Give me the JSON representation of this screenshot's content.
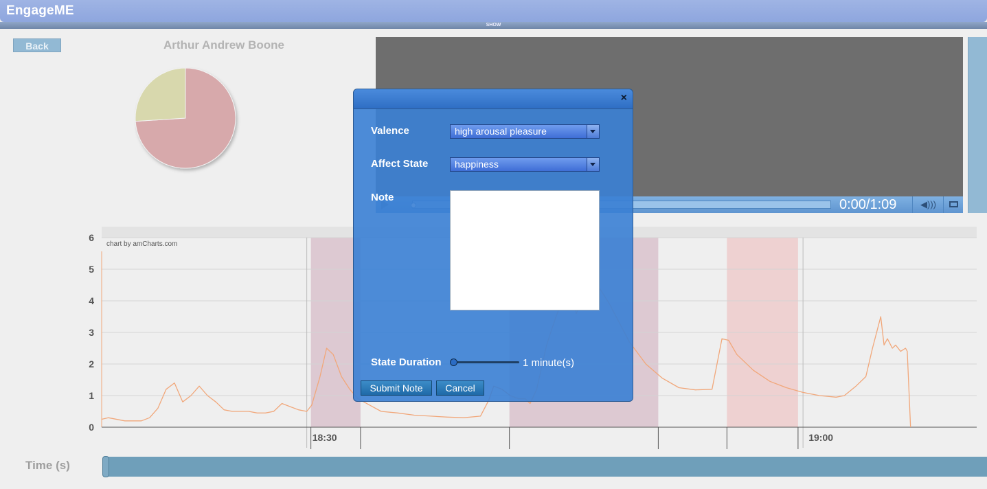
{
  "app": {
    "title": "EngageME",
    "show_label": "SHOW",
    "back_label": "Back",
    "person_name": "Arthur Andrew Boone"
  },
  "pie": {
    "slices": [
      {
        "value": 74,
        "color": "#d7a9ab"
      },
      {
        "value": 26,
        "color": "#d8d8ad"
      }
    ]
  },
  "video": {
    "time_display": "0:00/1:09",
    "progress": 0
  },
  "chart_data": {
    "type": "line",
    "watermark": "chart by amCharts.com",
    "ylim": [
      0,
      6
    ],
    "y_ticks": [
      "0",
      "1",
      "2",
      "3",
      "4",
      "5",
      "6"
    ],
    "x_tick_labels": [
      {
        "label": "18:30",
        "minute": 30
      },
      {
        "label": "19:00",
        "minute": 60
      }
    ],
    "x_range_minutes": [
      17.6,
      70.5
    ],
    "highlight_bands": [
      {
        "start": 30.25,
        "end": 33.25,
        "color": "#d9c2cc"
      },
      {
        "start": 42.25,
        "end": 51.25,
        "color": "#d9c2cc"
      },
      {
        "start": 55.4,
        "end": 59.7,
        "color": "#edcbcb"
      }
    ],
    "series": [
      {
        "color": "#f1a77a",
        "x": [
          17.6,
          18.0,
          19.0,
          20.0,
          20.5,
          21.0,
          21.5,
          22.0,
          22.5,
          23.0,
          23.5,
          24.0,
          24.5,
          25.0,
          25.5,
          26.0,
          26.5,
          27.0,
          27.5,
          28.0,
          28.5,
          29.0,
          29.5,
          30.0,
          30.3,
          30.8,
          31.2,
          31.6,
          32.1,
          32.6,
          33.1,
          33.8,
          34.5,
          35.5,
          36.5,
          37.5,
          38.5,
          39.5,
          40.5,
          41.0,
          41.3,
          41.8,
          42.3,
          42.8,
          43.2,
          43.5,
          43.9,
          44.5,
          45.0,
          45.5,
          46.0,
          46.3,
          46.8,
          47.2,
          47.7,
          48.3,
          48.8,
          49.5,
          50.5,
          51.5,
          52.5,
          53.5,
          54.5,
          55.1,
          55.5,
          56.0,
          57.0,
          58.0,
          59.0,
          60.0,
          61.0,
          62.0,
          62.5,
          63.2,
          63.8,
          64.2,
          64.5,
          64.7,
          64.9,
          65.1,
          65.4,
          65.6,
          65.9,
          66.2,
          66.3,
          66.5
        ],
        "y": [
          0.25,
          0.3,
          0.2,
          0.2,
          0.3,
          0.6,
          1.2,
          1.4,
          0.8,
          1.0,
          1.3,
          1.0,
          0.8,
          0.55,
          0.5,
          0.5,
          0.5,
          0.45,
          0.45,
          0.5,
          0.75,
          0.65,
          0.55,
          0.5,
          0.7,
          1.6,
          2.5,
          2.3,
          1.6,
          1.2,
          0.9,
          0.7,
          0.5,
          0.45,
          0.38,
          0.35,
          0.32,
          0.3,
          0.35,
          0.85,
          1.3,
          1.2,
          1.0,
          0.9,
          0.9,
          0.75,
          1.2,
          2.6,
          3.4,
          4.1,
          4.2,
          3.6,
          4.2,
          4.6,
          4.4,
          3.9,
          3.4,
          2.7,
          2.0,
          1.55,
          1.25,
          1.18,
          1.2,
          2.8,
          2.75,
          2.3,
          1.8,
          1.45,
          1.25,
          1.1,
          1.0,
          0.95,
          1.0,
          1.3,
          1.6,
          2.5,
          3.1,
          3.5,
          2.6,
          2.8,
          2.5,
          2.6,
          2.4,
          2.5,
          2.4,
          0
        ]
      }
    ]
  },
  "timeline": {
    "label": "Time (s)",
    "position": 0
  },
  "dialog": {
    "close_glyph": "×",
    "valence_label": "Valence",
    "valence_value": "high arousal pleasure",
    "affect_label": "Affect State",
    "affect_value": "happiness",
    "note_label": "Note",
    "note_value": "",
    "duration_label": "State Duration",
    "duration_value": "1 minute(s)",
    "duration_position": 0,
    "submit_label": "Submit Note",
    "cancel_label": "Cancel"
  }
}
